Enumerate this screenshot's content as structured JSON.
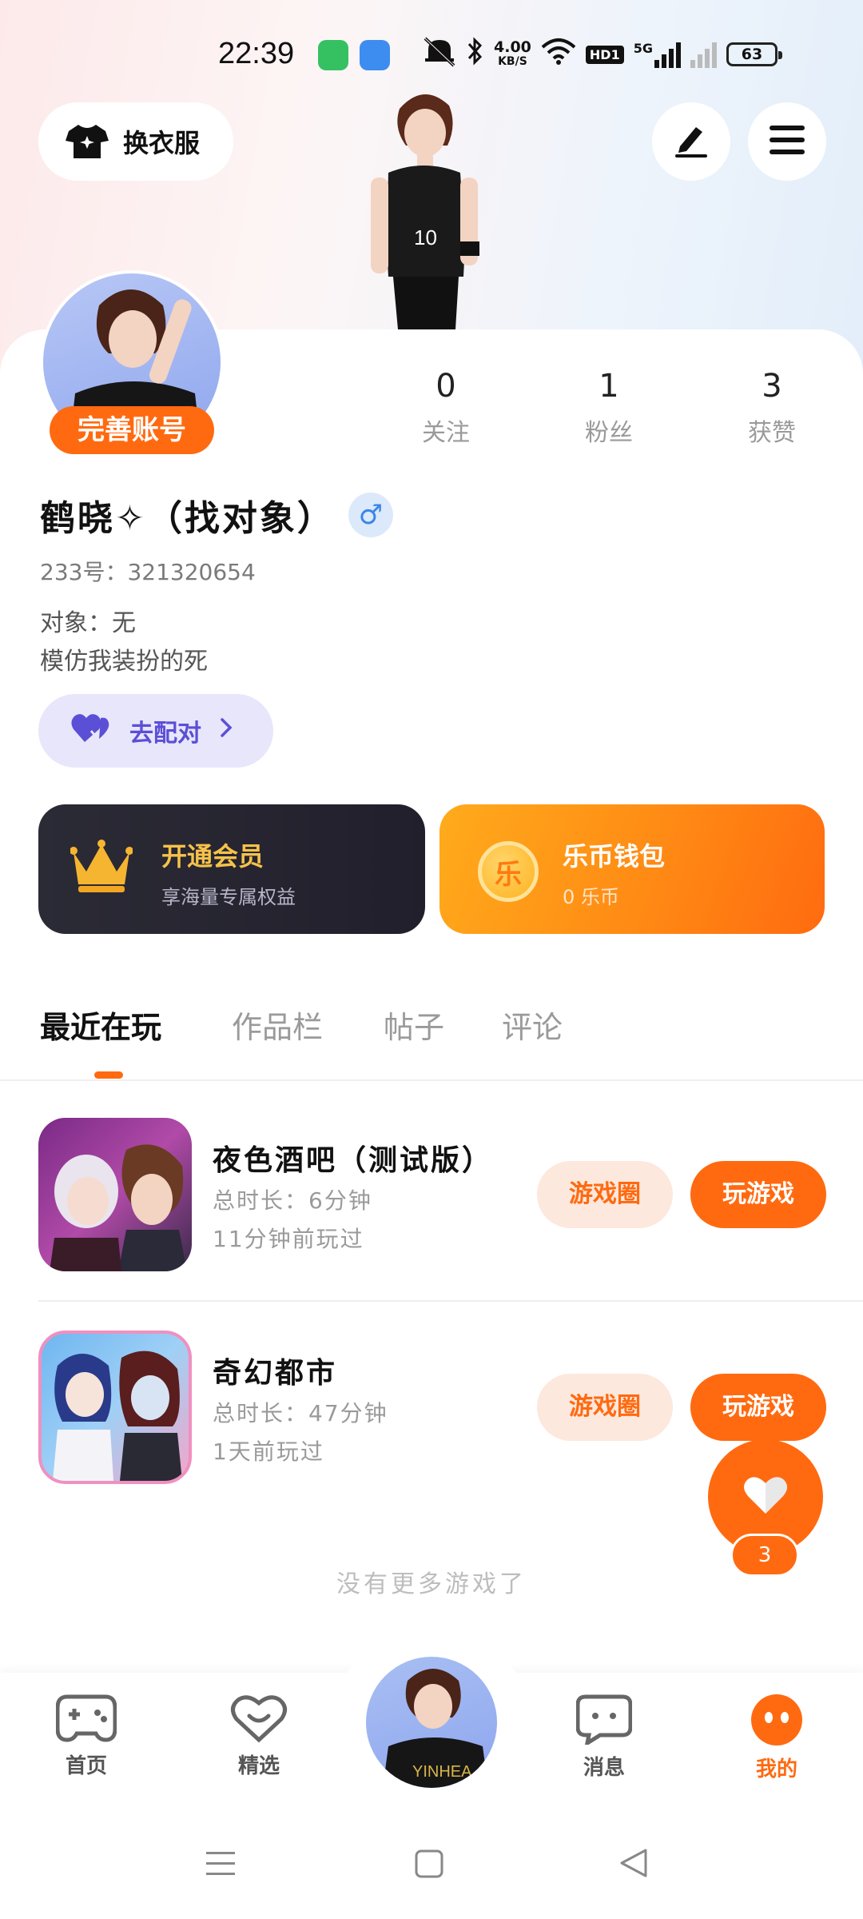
{
  "status_bar": {
    "time": "22:39",
    "net_speed_value": "4.00",
    "net_speed_unit": "KB/S",
    "hd": "HD1",
    "network": "5G",
    "battery": "63"
  },
  "header": {
    "dress_button_label": "换衣服"
  },
  "profile": {
    "complete_badge": "完善账号",
    "stats": [
      {
        "value": "0",
        "label": "关注"
      },
      {
        "value": "1",
        "label": "粉丝"
      },
      {
        "value": "3",
        "label": "获赞"
      }
    ],
    "name": "鹤晓✧（找对象）",
    "gender_symbol": "♂",
    "uid": "233号：321320654",
    "partner": "对象：无",
    "bio": "模仿我装扮的死",
    "match_button": "去配对"
  },
  "promos": {
    "vip": {
      "title": "开通会员",
      "subtitle": "享海量专属权益"
    },
    "wallet": {
      "title": "乐币钱包",
      "subtitle": "0 乐币",
      "coin_glyph": "乐"
    }
  },
  "tabs": [
    "最近在玩",
    "作品栏",
    "帖子",
    "评论"
  ],
  "games": [
    {
      "title": "夜色酒吧（测试版）",
      "duration": "总时长：6分钟",
      "last_played": "11分钟前玩过",
      "circle_label": "游戏圈",
      "play_label": "玩游戏"
    },
    {
      "title": "奇幻都市",
      "duration": "总时长：47分钟",
      "last_played": "1天前玩过",
      "circle_label": "游戏圈",
      "play_label": "玩游戏"
    }
  ],
  "no_more": "没有更多游戏了",
  "like_fab": {
    "count": "3"
  },
  "bottom_nav": [
    {
      "label": "首页"
    },
    {
      "label": "精选"
    },
    {
      "label": "消息"
    },
    {
      "label": "我的"
    }
  ],
  "colors": {
    "accent": "#ff6a10",
    "match": "#5b4fd6",
    "gender": "#3b86e8"
  }
}
